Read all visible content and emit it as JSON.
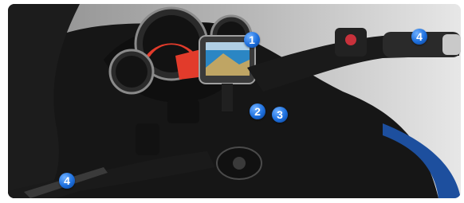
{
  "image": {
    "markers": [
      {
        "label": "1"
      },
      {
        "label": "2"
      },
      {
        "label": "3"
      },
      {
        "label": "4"
      },
      {
        "label": "4"
      }
    ],
    "colors": {
      "marker": "#1d6fdd",
      "marker_text": "#ffffff",
      "background_left": "#8d8d8d",
      "background_right": "#e7e7e7",
      "gauge_red": "#e23b2b",
      "gps_screen": "#2b86c4"
    }
  }
}
